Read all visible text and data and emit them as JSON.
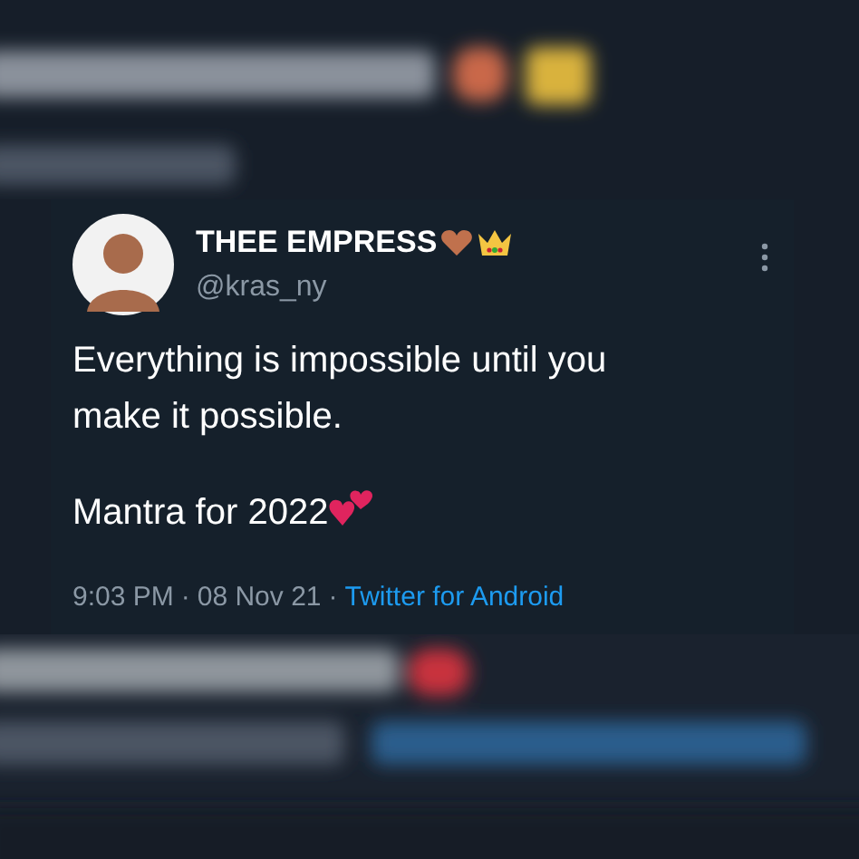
{
  "tweet": {
    "display_name": "THEE EMPRESS",
    "handle": "@kras_ny",
    "text_lines": [
      "Everything is impossible until you make it possible.",
      "Mantra for 2022"
    ],
    "time": "9:03 PM",
    "separator": "·",
    "date": "08 Nov 21",
    "source": "Twitter for Android"
  }
}
